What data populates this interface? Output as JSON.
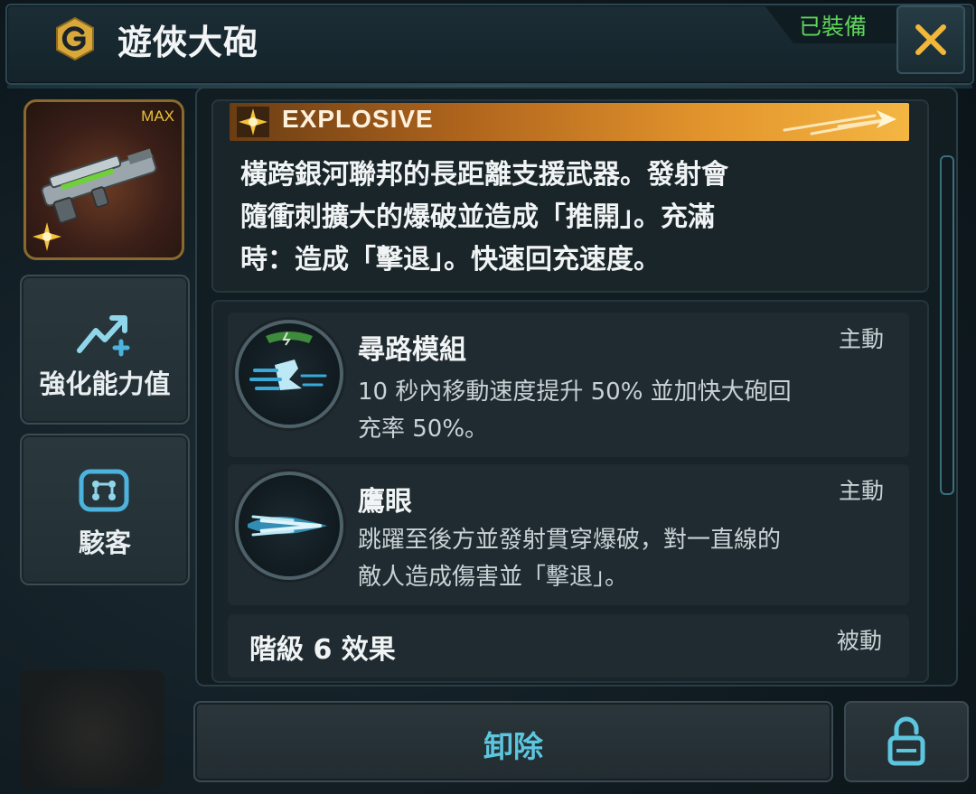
{
  "header": {
    "title": "遊俠大砲",
    "equipped_label": "已裝備",
    "colors": {
      "gold": "#d8a93a",
      "equipped": "#5fd35a"
    }
  },
  "weapon": {
    "badge": "MAX",
    "element_icon": "explosive-star-icon"
  },
  "sidebar": {
    "items": [
      {
        "label": "強化能力值",
        "icon": "upgrade-arrow-icon"
      },
      {
        "label": "駭客",
        "icon": "chip-icon"
      }
    ]
  },
  "description": {
    "type_label": "EXPLOSIVE",
    "lines": [
      "橫跨銀河聯邦的長距離支援武器。發射會",
      "隨衝刺擴大的爆破並造成「推開」。充滿",
      "時：造成「擊退」。快速回充速度。"
    ]
  },
  "skills": [
    {
      "name": "尋路模組",
      "type": "主動",
      "desc_lines": [
        "10 秒內移動速度提升 50% 並加快大砲回",
        "充率 50%。"
      ],
      "icon": "sprint-boot-icon"
    },
    {
      "name": "鷹眼",
      "type": "主動",
      "desc_lines": [
        "跳躍至後方並發射貫穿爆破，對一直線的",
        "敵人造成傷害並「擊退」。"
      ],
      "icon": "piercing-blast-icon"
    },
    {
      "name": "階級 6 效果",
      "type": "被動"
    }
  ],
  "footer": {
    "unequip_label": "卸除",
    "lock_icon": "unlock-icon",
    "accent": "#5cc6df"
  }
}
